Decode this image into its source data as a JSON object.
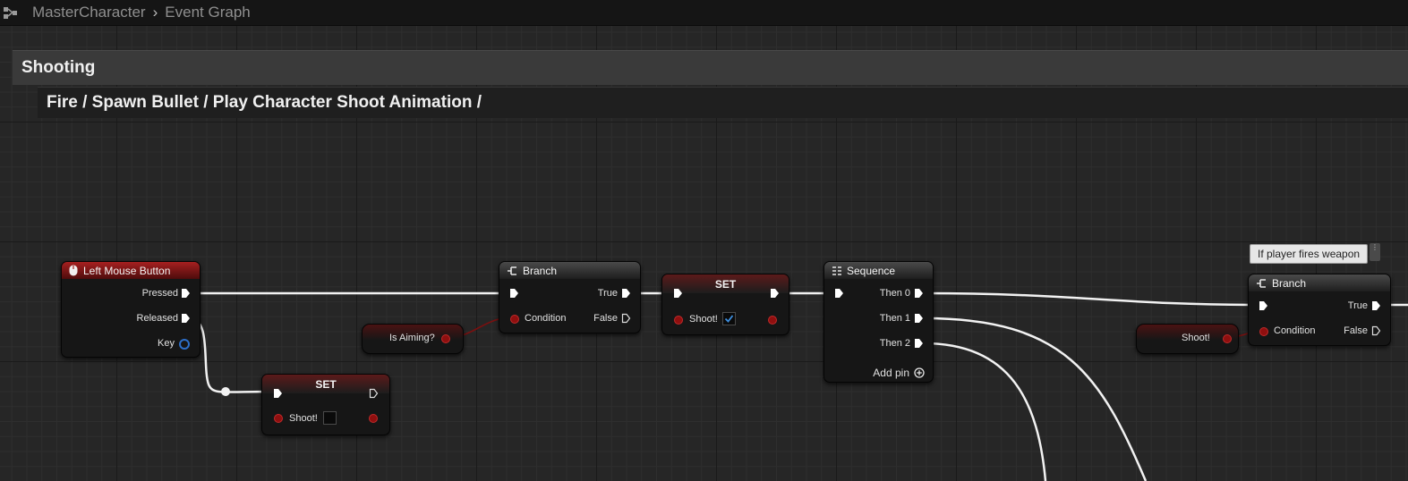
{
  "breadcrumb": {
    "parent": "MasterCharacter",
    "current": "Event Graph"
  },
  "comments": {
    "outer": "Shooting",
    "inner": "Fire / Spawn Bullet / Play Character Shoot Animation /"
  },
  "nodes": {
    "lmb": {
      "title": "Left Mouse Button",
      "pressed": "Pressed",
      "released": "Released",
      "key": "Key"
    },
    "branch1": {
      "title": "Branch",
      "condition": "Condition",
      "true": "True",
      "false": "False"
    },
    "set_true": {
      "title": "SET",
      "var": "Shoot!",
      "checked": true
    },
    "set_false": {
      "title": "SET",
      "var": "Shoot!",
      "checked": false
    },
    "sequence": {
      "title": "Sequence",
      "then0": "Then 0",
      "then1": "Then 1",
      "then2": "Then 2",
      "add_pin": "Add pin"
    },
    "branch2": {
      "title": "Branch",
      "condition": "Condition",
      "true": "True",
      "false": "False"
    },
    "get_aiming": {
      "label": "Is Aiming?"
    },
    "get_shoot": {
      "label": "Shoot!"
    }
  },
  "tooltip": {
    "text": "If player fires weapon"
  },
  "colors": {
    "exec": "#ffffff",
    "bool_pin": "#8f0f0f",
    "bool_wire": "#7a1010",
    "struct_pin": "#2d6fc9",
    "event_header": "#a62020"
  },
  "icons": {
    "graph": "graph-icon",
    "mouse": "mouse-icon",
    "branch": "branch-icon",
    "sequence": "sequence-icon",
    "add": "add-pin-icon",
    "check": "checkmark-icon"
  }
}
